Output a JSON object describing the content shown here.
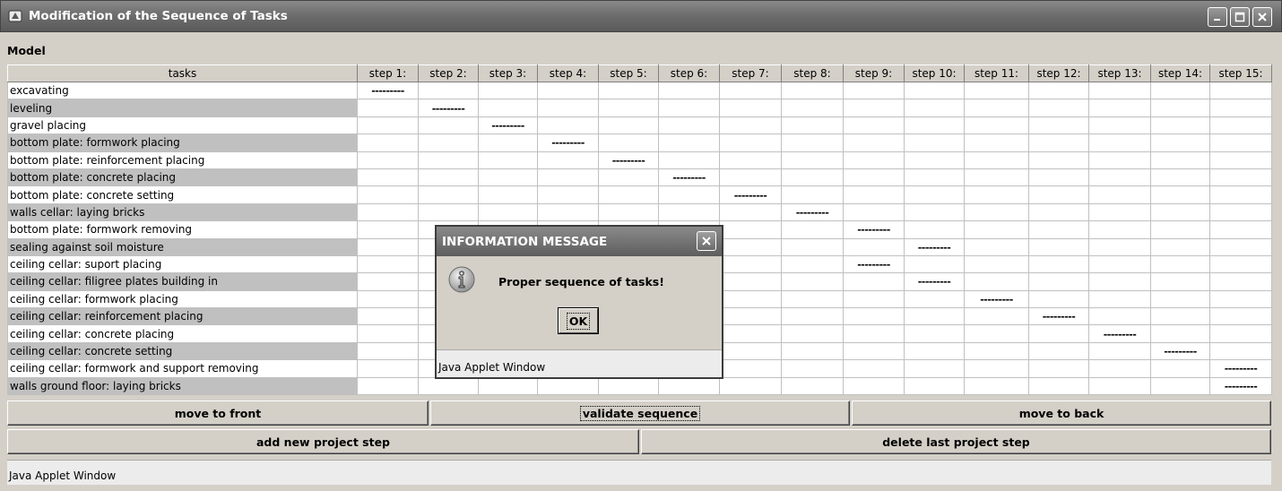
{
  "window": {
    "title": "Modification of the Sequence of Tasks",
    "icon": "applet-icon",
    "controls": [
      "minimize-icon",
      "maximize-icon",
      "close-icon"
    ]
  },
  "model_label": "Model",
  "table": {
    "task_header": "tasks",
    "steps": [
      "step 1:",
      "step 2:",
      "step 3:",
      "step 4:",
      "step 5:",
      "step 6:",
      "step 7:",
      "step 8:",
      "step 9:",
      "step 10:",
      "step 11:",
      "step 12:",
      "step 13:",
      "step 14:",
      "step 15:"
    ],
    "marker": "---------",
    "rows": [
      {
        "task": "excavating",
        "step": 1
      },
      {
        "task": "leveling",
        "step": 2
      },
      {
        "task": "gravel placing",
        "step": 3
      },
      {
        "task": "bottom plate: formwork placing",
        "step": 4
      },
      {
        "task": "bottom plate: reinforcement placing",
        "step": 5
      },
      {
        "task": "bottom plate: concrete placing",
        "step": 6
      },
      {
        "task": "bottom plate: concrete setting",
        "step": 7
      },
      {
        "task": "walls cellar: laying bricks",
        "step": 8
      },
      {
        "task": "bottom plate: formwork removing",
        "step": 9
      },
      {
        "task": "sealing against soil moisture",
        "step": 10
      },
      {
        "task": "ceiling cellar: suport placing",
        "step": 9
      },
      {
        "task": "ceiling cellar: filigree plates building in",
        "step": 10
      },
      {
        "task": "ceiling cellar: formwork placing",
        "step": 11
      },
      {
        "task": "ceiling cellar: reinforcement placing",
        "step": 12
      },
      {
        "task": "ceiling cellar: concrete placing",
        "step": 13
      },
      {
        "task": "ceiling cellar: concrete setting",
        "step": 14
      },
      {
        "task": "ceiling cellar: formwork and support removing",
        "step": 15
      },
      {
        "task": "walls ground floor: laying bricks",
        "step": 15
      }
    ]
  },
  "buttons": {
    "move_front": "move to front",
    "validate": "validate sequence",
    "move_back": "move to back",
    "add_step": "add new project step",
    "delete_step": "delete last project step"
  },
  "status": "Java Applet Window",
  "dialog": {
    "title": "INFORMATION MESSAGE",
    "message": "Proper sequence of tasks!",
    "ok": "OK",
    "status": "Java Applet Window",
    "icon": "info-icon"
  }
}
